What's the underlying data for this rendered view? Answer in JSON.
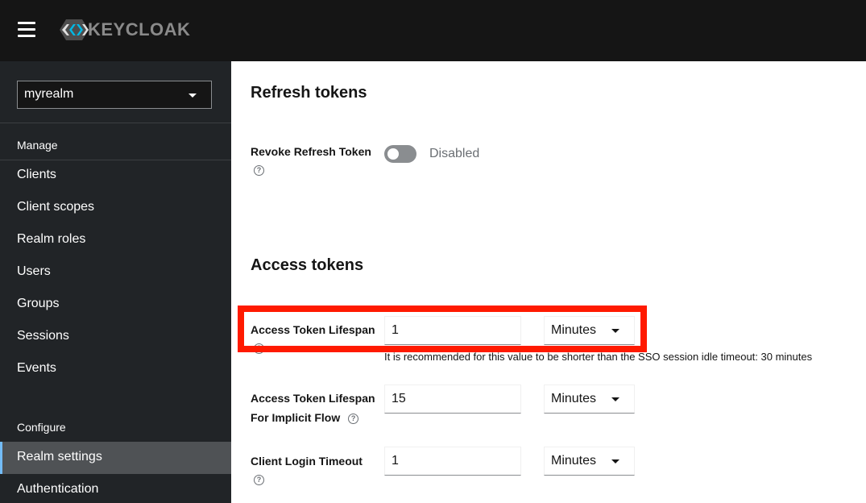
{
  "masthead": {
    "menu_icon": "hamburger-icon",
    "logo_text": "KEYCLOAK",
    "logo_icon": "keycloak-logo-icon"
  },
  "sidebar": {
    "realm_selector": {
      "value": "myrealm",
      "icon": "caret-down-icon"
    },
    "sections": [
      {
        "label": "Manage",
        "items": [
          "Clients",
          "Client scopes",
          "Realm roles",
          "Users",
          "Groups",
          "Sessions",
          "Events"
        ]
      },
      {
        "label": "Configure",
        "items": [
          "Realm settings",
          "Authentication"
        ]
      }
    ],
    "active_item": "Realm settings"
  },
  "main": {
    "refresh_tokens": {
      "title": "Refresh tokens",
      "revoke_refresh_token": {
        "label": "Revoke Refresh Token",
        "enabled": false,
        "status_text": "Disabled"
      }
    },
    "access_tokens": {
      "title": "Access tokens",
      "fields": [
        {
          "label": "Access Token Lifespan",
          "value": "1",
          "unit": "Minutes",
          "helper": "It is recommended for this value to be shorter than the SSO session idle timeout: 30 minutes",
          "highlighted": true
        },
        {
          "label_line1": "Access Token Lifespan",
          "label_line2": "For Implicit Flow",
          "value": "15",
          "unit": "Minutes"
        },
        {
          "label": "Client Login Timeout",
          "value": "1",
          "unit": "Minutes"
        }
      ]
    }
  },
  "colors": {
    "masthead_bg": "#151515",
    "sidebar_bg": "#212427",
    "active_item_bg": "#4f5255",
    "highlight_border": "#ff1a00"
  }
}
